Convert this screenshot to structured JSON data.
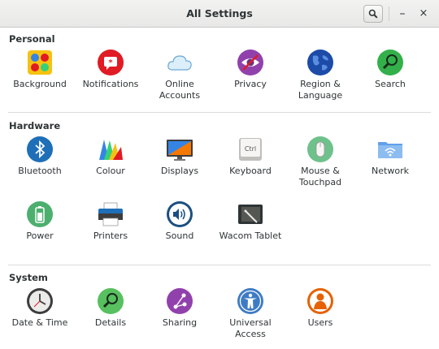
{
  "window": {
    "title": "All Settings",
    "search_icon": "search-icon",
    "minimize_glyph": "–",
    "close_glyph": "×"
  },
  "sections": {
    "personal": {
      "title": "Personal",
      "items": [
        {
          "label": "Background",
          "icon": "background-icon"
        },
        {
          "label": "Notifications",
          "icon": "notifications-icon"
        },
        {
          "label": "Online\nAccounts",
          "icon": "online-accounts-icon"
        },
        {
          "label": "Privacy",
          "icon": "privacy-icon"
        },
        {
          "label": "Region &\nLanguage",
          "icon": "region-language-icon"
        },
        {
          "label": "Search",
          "icon": "search-icon"
        }
      ]
    },
    "hardware": {
      "title": "Hardware",
      "items": [
        {
          "label": "Bluetooth",
          "icon": "bluetooth-icon"
        },
        {
          "label": "Colour",
          "icon": "colour-icon"
        },
        {
          "label": "Displays",
          "icon": "displays-icon"
        },
        {
          "label": "Keyboard",
          "icon": "keyboard-icon",
          "key_text": "Ctrl"
        },
        {
          "label": "Mouse &\nTouchpad",
          "icon": "mouse-icon"
        },
        {
          "label": "Network",
          "icon": "network-icon"
        },
        {
          "label": "Power",
          "icon": "power-icon"
        },
        {
          "label": "Printers",
          "icon": "printer-icon"
        },
        {
          "label": "Sound",
          "icon": "sound-icon"
        },
        {
          "label": "Wacom Tablet",
          "icon": "wacom-tablet-icon"
        }
      ]
    },
    "system": {
      "title": "System",
      "items": [
        {
          "label": "Date & Time",
          "icon": "clock-icon"
        },
        {
          "label": "Details",
          "icon": "details-icon"
        },
        {
          "label": "Sharing",
          "icon": "sharing-icon"
        },
        {
          "label": "Universal\nAccess",
          "icon": "universal-access-icon"
        },
        {
          "label": "Users",
          "icon": "users-icon"
        }
      ]
    }
  }
}
